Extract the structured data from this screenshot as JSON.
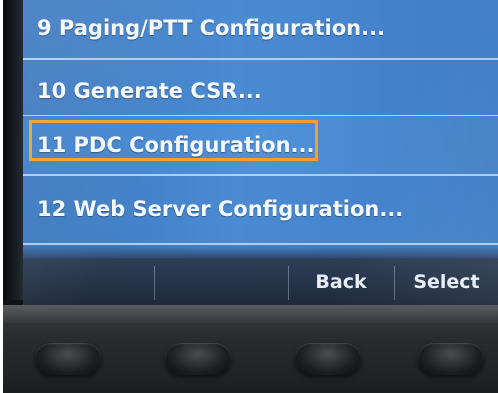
{
  "menu": {
    "items": [
      {
        "label": "9 Paging/PTT Configuration..."
      },
      {
        "label": "10 Generate CSR..."
      },
      {
        "label": "11 PDC Configuration..."
      },
      {
        "label": "12 Web Server Configuration..."
      }
    ],
    "selected_index": 2
  },
  "softkeys": {
    "back_label": "Back",
    "select_label": "Select"
  },
  "colors": {
    "screen_blue": "#4a8bd2",
    "highlight_border": "#f0a226",
    "softkey_bar": "#243247"
  }
}
